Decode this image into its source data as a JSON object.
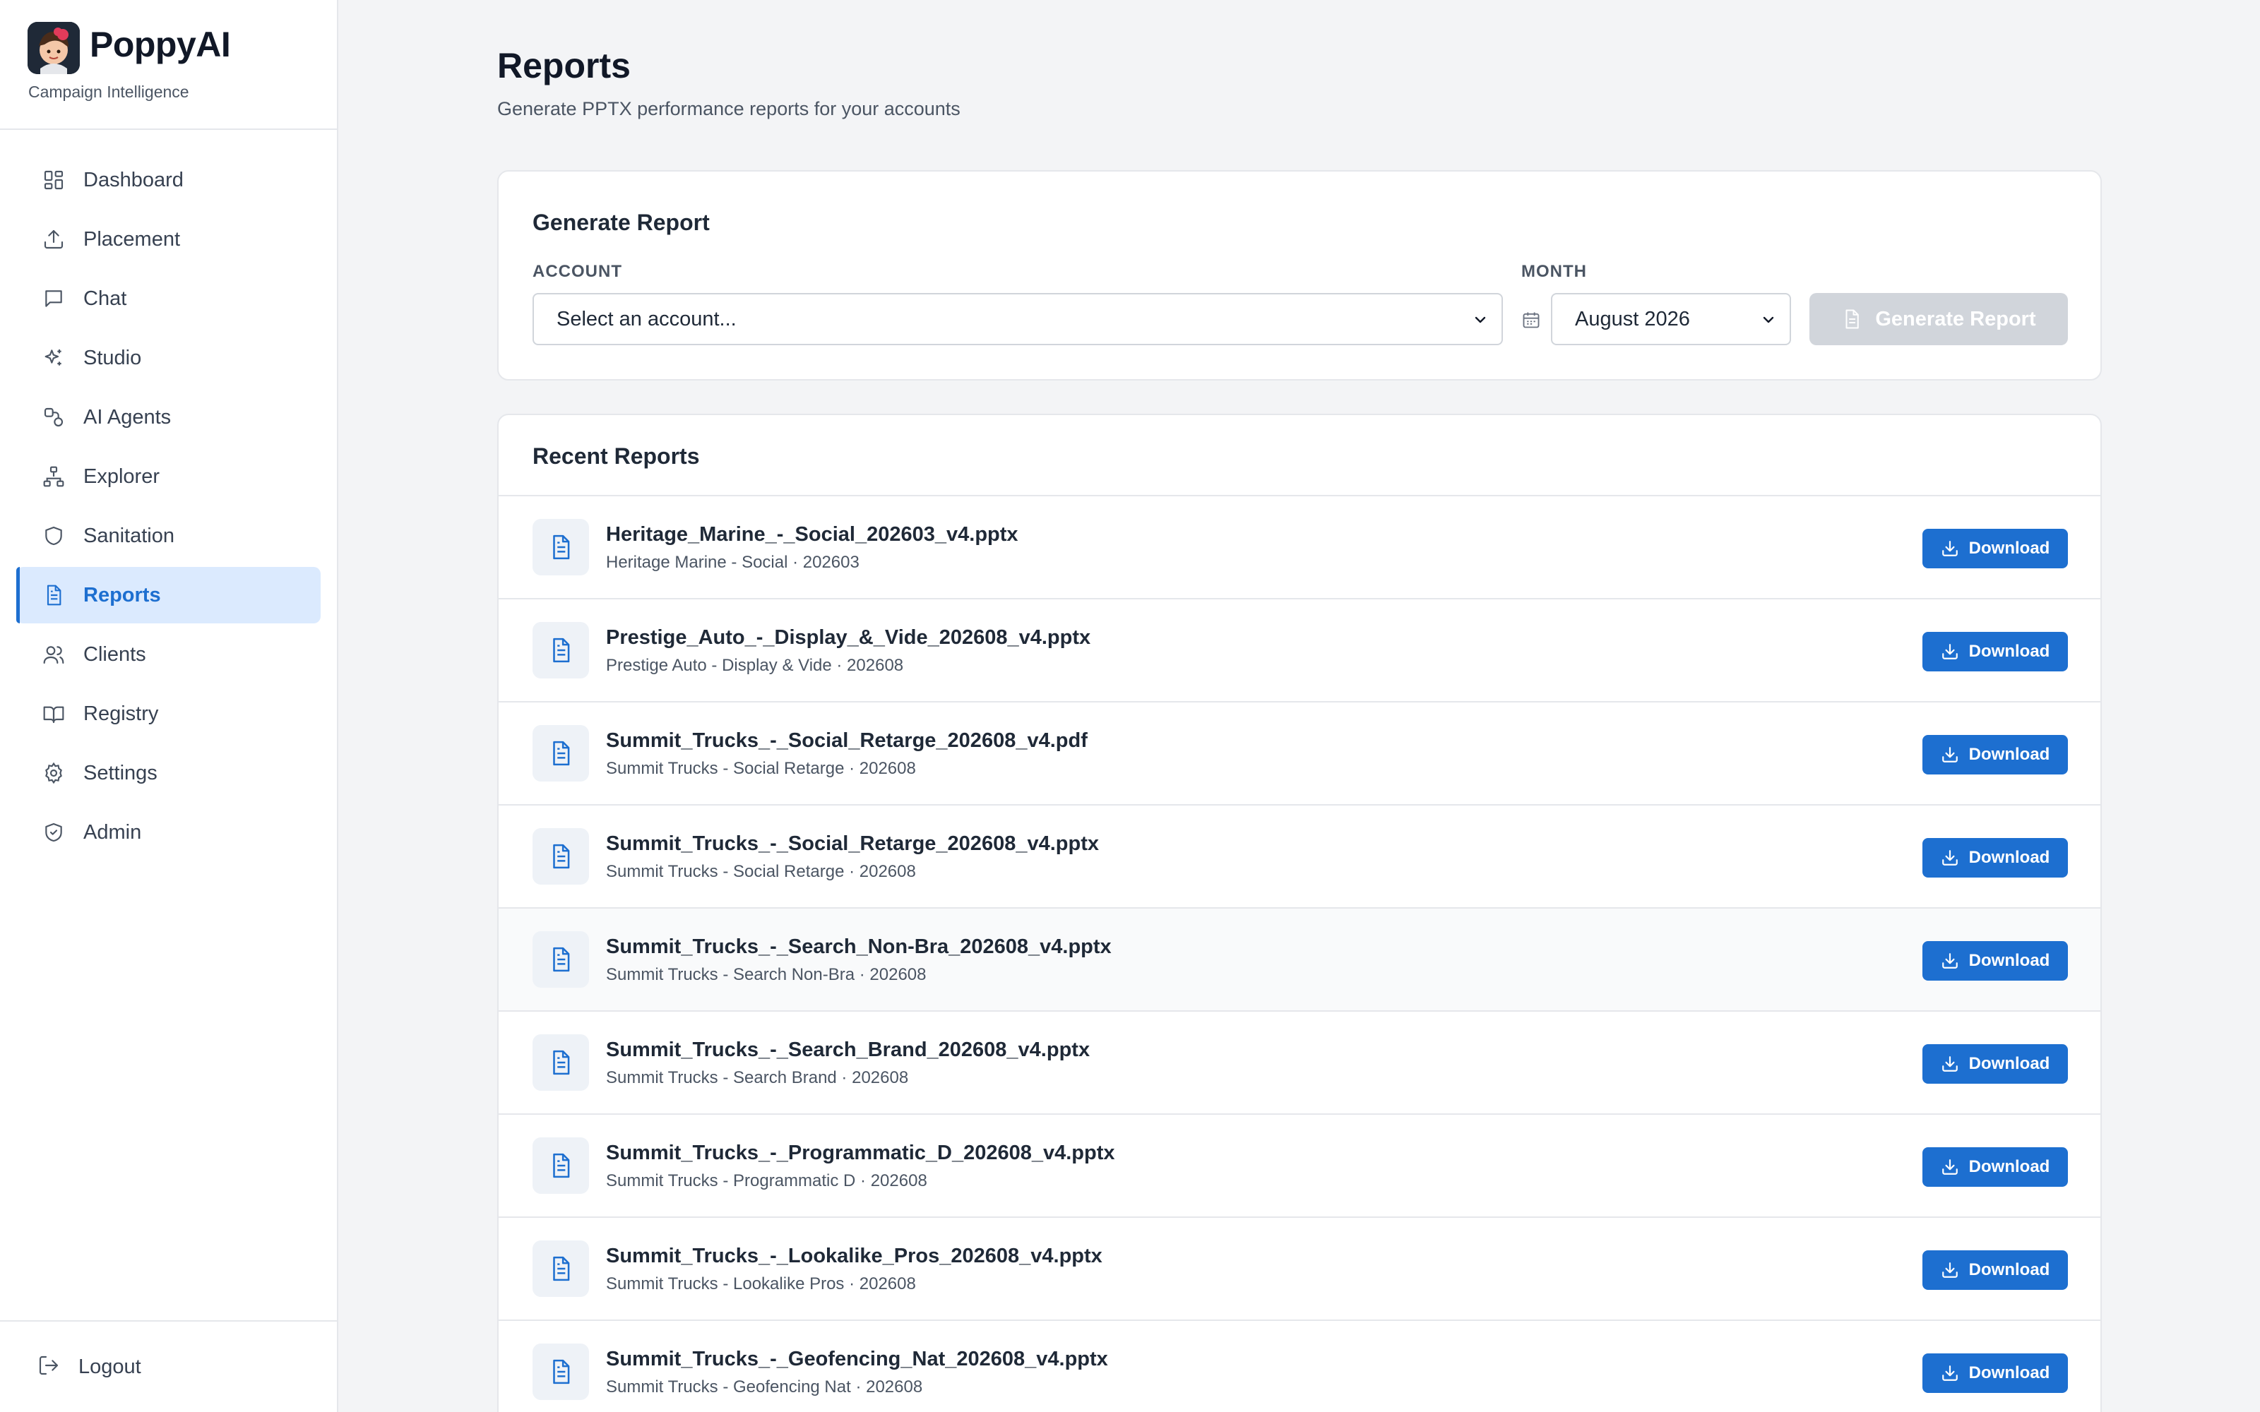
{
  "brand": {
    "name": "PoppyAI",
    "tagline": "Campaign Intelligence"
  },
  "sidebar": {
    "items": [
      {
        "label": "Dashboard",
        "icon": "dashboard-icon",
        "active": false
      },
      {
        "label": "Placement",
        "icon": "upload-icon",
        "active": false
      },
      {
        "label": "Chat",
        "icon": "chat-icon",
        "active": false
      },
      {
        "label": "Studio",
        "icon": "sparkles-icon",
        "active": false
      },
      {
        "label": "AI Agents",
        "icon": "agents-icon",
        "active": false
      },
      {
        "label": "Explorer",
        "icon": "hierarchy-icon",
        "active": false
      },
      {
        "label": "Sanitation",
        "icon": "shield-icon",
        "active": false
      },
      {
        "label": "Reports",
        "icon": "file-text-icon",
        "active": true
      },
      {
        "label": "Clients",
        "icon": "users-icon",
        "active": false
      },
      {
        "label": "Registry",
        "icon": "book-icon",
        "active": false
      },
      {
        "label": "Settings",
        "icon": "gear-icon",
        "active": false
      },
      {
        "label": "Admin",
        "icon": "shield-check-icon",
        "active": false
      }
    ],
    "logout_label": "Logout"
  },
  "page": {
    "title": "Reports",
    "subtitle": "Generate PPTX performance reports for your accounts"
  },
  "generate": {
    "title": "Generate Report",
    "account_label": "ACCOUNT",
    "account_value": "Select an account...",
    "month_label": "MONTH",
    "month_value": "August 2026",
    "button_label": "Generate Report"
  },
  "recent": {
    "title": "Recent Reports",
    "download_label": "Download",
    "rows": [
      {
        "name": "Heritage_Marine_-_Social_202603_v4.pptx",
        "meta": "Heritage Marine - Social · 202603"
      },
      {
        "name": "Prestige_Auto_-_Display_&_Vide_202608_v4.pptx",
        "meta": "Prestige Auto - Display & Vide · 202608"
      },
      {
        "name": "Summit_Trucks_-_Social_Retarge_202608_v4.pdf",
        "meta": "Summit Trucks - Social Retarge · 202608"
      },
      {
        "name": "Summit_Trucks_-_Social_Retarge_202608_v4.pptx",
        "meta": "Summit Trucks - Social Retarge · 202608"
      },
      {
        "name": "Summit_Trucks_-_Search_Non-Bra_202608_v4.pptx",
        "meta": "Summit Trucks - Search Non-Bra · 202608"
      },
      {
        "name": "Summit_Trucks_-_Search_Brand_202608_v4.pptx",
        "meta": "Summit Trucks - Search Brand · 202608"
      },
      {
        "name": "Summit_Trucks_-_Programmatic_D_202608_v4.pptx",
        "meta": "Summit Trucks - Programmatic D · 202608"
      },
      {
        "name": "Summit_Trucks_-_Lookalike_Pros_202608_v4.pptx",
        "meta": "Summit Trucks - Lookalike Pros · 202608"
      },
      {
        "name": "Summit_Trucks_-_Geofencing_Nat_202608_v4.pptx",
        "meta": "Summit Trucks - Geofencing Nat · 202608"
      }
    ]
  },
  "colors": {
    "accent": "#1d6fd0",
    "active_bg": "#dbeafe",
    "disabled": "#d1d5db"
  }
}
